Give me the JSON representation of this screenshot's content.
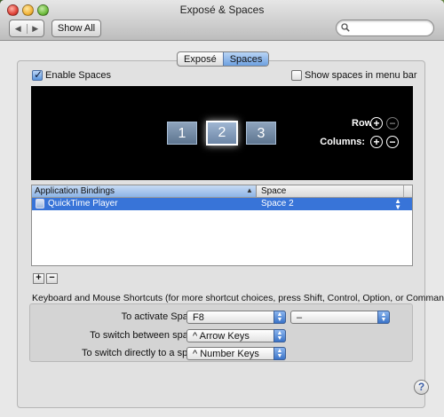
{
  "window": {
    "title": "Exposé & Spaces"
  },
  "toolbar": {
    "back_glyph": "◀",
    "forward_glyph": "▶",
    "show_all_label": "Show All",
    "search_value": "",
    "search_placeholder": ""
  },
  "tabs": [
    {
      "label": "Exposé",
      "selected": false
    },
    {
      "label": "Spaces",
      "selected": true
    }
  ],
  "options": {
    "enable_spaces_label": "Enable Spaces",
    "enable_spaces_checked": true,
    "show_menu_bar_label": "Show spaces in menu bar",
    "show_menu_bar_checked": false
  },
  "spaces_grid": {
    "tiles": [
      "1",
      "2",
      "3"
    ],
    "active": "2",
    "rows_label": "Rows:",
    "columns_label": "Columns:",
    "add_glyph": "+",
    "remove_glyph": "−"
  },
  "bindings_table": {
    "columns": [
      "Application Bindings",
      "Space"
    ],
    "rows": [
      {
        "application": "QuickTime Player",
        "space": "Space 2",
        "selected": true
      }
    ],
    "add_label": "+",
    "remove_label": "−"
  },
  "shortcuts": {
    "title": "Keyboard and Mouse Shortcuts (for more shortcut choices, press Shift, Control, Option, or Command)",
    "activate_label": "To activate Spaces:",
    "activate_key": "F8",
    "activate_mouse": "–",
    "switch_between_label": "To switch between spaces:",
    "switch_between_value": "^ Arrow Keys",
    "switch_direct_label": "To switch directly to a space:",
    "switch_direct_value": "^ Number Keys"
  },
  "help_glyph": "?",
  "colors": {
    "selection_blue": "#3874d8",
    "popup_arrow_blue": "#3a73c8",
    "spaces_background": "#000000"
  }
}
